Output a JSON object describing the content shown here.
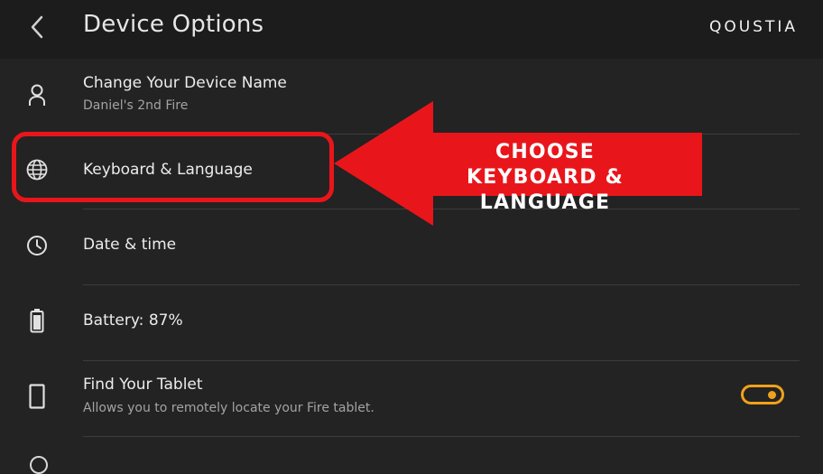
{
  "header": {
    "title": "Device Options",
    "brand": "QOUSTIA"
  },
  "rows": [
    {
      "icon": "person-icon",
      "title": "Change Your Device Name",
      "subtitle": "Daniel's 2nd Fire"
    },
    {
      "icon": "globe-icon",
      "title": "Keyboard  & Language"
    },
    {
      "icon": "clock-icon",
      "title": "Date & time"
    },
    {
      "icon": "battery-icon",
      "title": "Battery: 87%"
    },
    {
      "icon": "tablet-icon",
      "title": "Find Your Tablet",
      "subtitle": "Allows you to remotely locate your Fire tablet.",
      "toggle_on": true
    }
  ],
  "annotation": {
    "line1": "CHOOSE",
    "line2": "KEYBOARD & LANGUAGE"
  },
  "colors": {
    "background": "#232323",
    "header": "#1c1c1c",
    "accent_toggle": "#f0a21b",
    "annotation_red": "#e8161b"
  }
}
